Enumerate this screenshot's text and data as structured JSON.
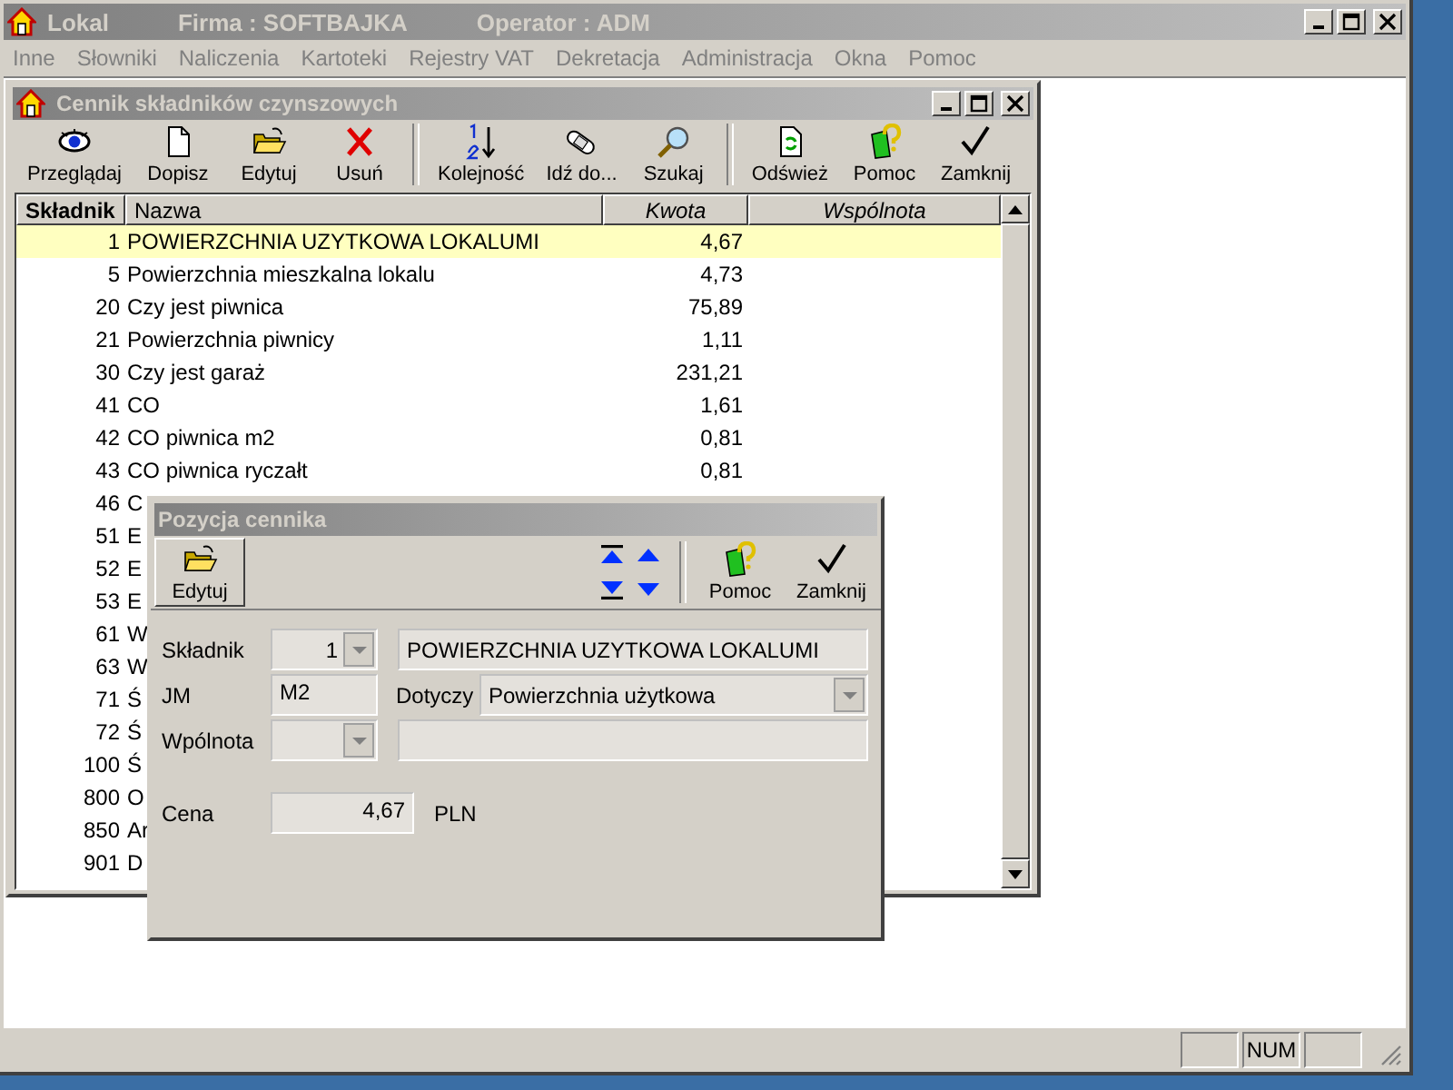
{
  "main_window": {
    "title": "Lokal",
    "firma": "Firma : SOFTBAJKA",
    "operator": "Operator : ADM"
  },
  "menu": [
    "Inne",
    "Słowniki",
    "Naliczenia",
    "Kartoteki",
    "Rejestry VAT",
    "Dekretacja",
    "Administracja",
    "Okna",
    "Pomoc"
  ],
  "price_list_window": {
    "title": "Cennik składników czynszowych",
    "toolbar_groups": [
      [
        "Przeglądaj",
        "Dopisz",
        "Edytuj",
        "Usuń"
      ],
      [
        "Kolejność",
        "Idź do...",
        "Szukaj"
      ],
      [
        "Odśwież",
        "Pomoc",
        "Zamknij"
      ]
    ],
    "table": {
      "columns": [
        "Składnik",
        "Nazwa",
        "Kwota",
        "Wspólnota"
      ],
      "rows": [
        {
          "id": "1",
          "name": "POWIERZCHNIA UZYTKOWA LOKALUMI",
          "amount": "4,67",
          "selected": true
        },
        {
          "id": "5",
          "name": "Powierzchnia mieszkalna lokalu",
          "amount": "4,73",
          "selected": false
        },
        {
          "id": "20",
          "name": "Czy jest piwnica",
          "amount": "75,89",
          "selected": false
        },
        {
          "id": "21",
          "name": "Powierzchnia  piwnicy",
          "amount": "1,11",
          "selected": false
        },
        {
          "id": "30",
          "name": "Czy jest garaż",
          "amount": "231,21",
          "selected": false
        },
        {
          "id": "41",
          "name": "CO",
          "amount": "1,61",
          "selected": false
        },
        {
          "id": "42",
          "name": "CO piwnica m2",
          "amount": "0,81",
          "selected": false
        },
        {
          "id": "43",
          "name": "CO piwnica ryczałt",
          "amount": "0,81",
          "selected": false
        },
        {
          "id": "46",
          "name": "C",
          "selected": false
        },
        {
          "id": "51",
          "name": "E",
          "selected": false
        },
        {
          "id": "52",
          "name": "E",
          "selected": false
        },
        {
          "id": "53",
          "name": "E",
          "selected": false
        },
        {
          "id": "61",
          "name": "W",
          "selected": false
        },
        {
          "id": "63",
          "name": "W",
          "selected": false
        },
        {
          "id": "71",
          "name": "Ś",
          "selected": false
        },
        {
          "id": "72",
          "name": "Ś",
          "selected": false
        },
        {
          "id": "100",
          "name": "Ś",
          "selected": false
        },
        {
          "id": "800",
          "name": "O",
          "selected": false
        },
        {
          "id": "850",
          "name": "Ar",
          "selected": false
        },
        {
          "id": "901",
          "name": "D",
          "selected": false
        }
      ]
    }
  },
  "dialog": {
    "title": "Pozycja cennika",
    "edit_button": {
      "label": "Edytuj"
    },
    "buttons": [
      {
        "label": "Pomoc"
      },
      {
        "label": "Zamknij"
      }
    ],
    "skladnik": {
      "label": "Składnik",
      "value": "1",
      "name": "POWIERZCHNIA UZYTKOWA LOKALUMI"
    },
    "jm": {
      "label": "JM",
      "value": "M2"
    },
    "dotyczy": {
      "label": "Dotyczy",
      "value": "Powierzchnia użytkowa"
    },
    "wspolnota": {
      "label": "Wpólnota"
    },
    "cena": {
      "label": "Cena",
      "value": "4,67",
      "currency": "PLN"
    }
  },
  "status_bar": {
    "num": "NUM"
  }
}
